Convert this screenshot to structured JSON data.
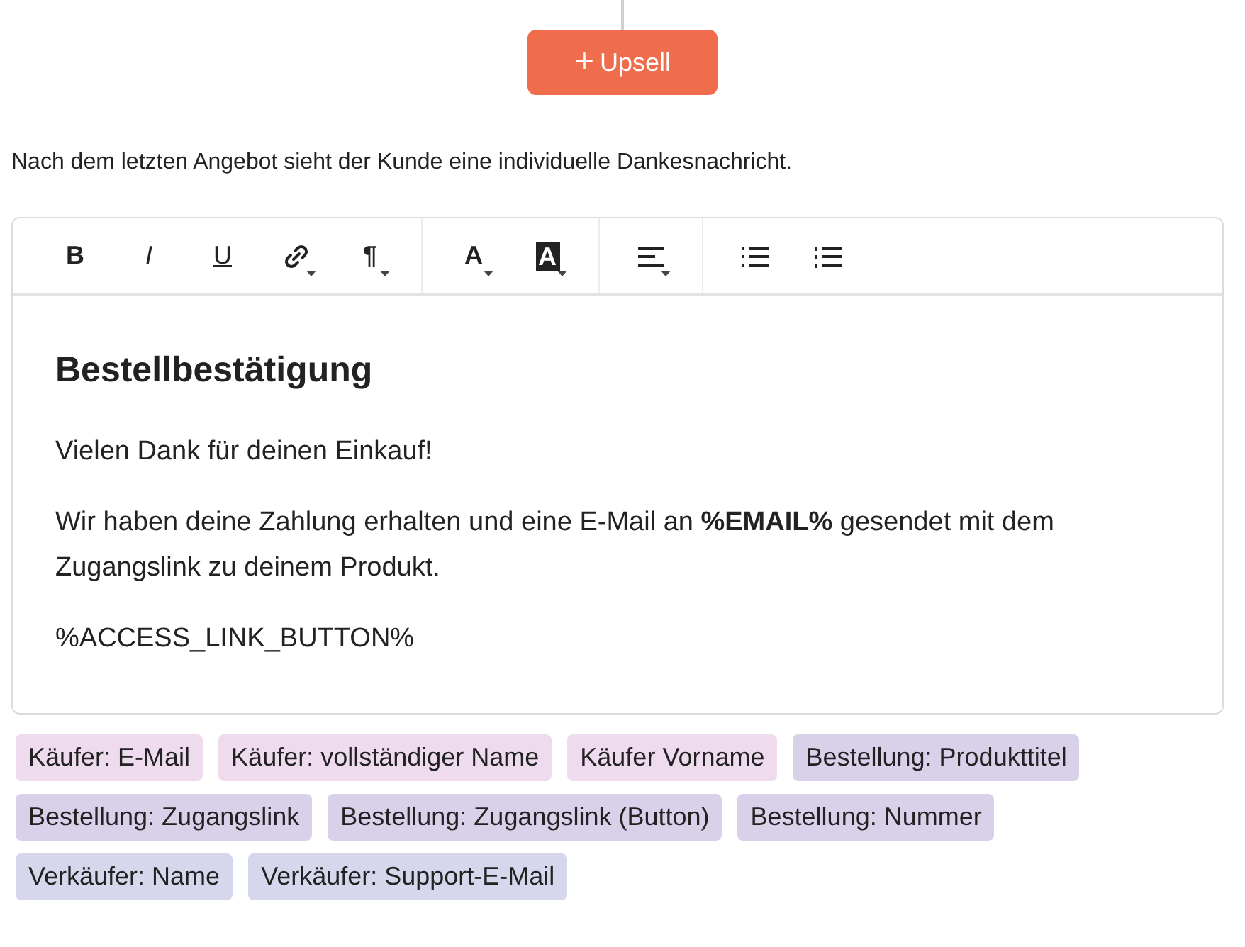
{
  "add_button": {
    "icon": "+",
    "label": "Upsell"
  },
  "description": "Nach dem letzten Angebot sieht der Kunde eine individuelle Dankesnachricht.",
  "toolbar": [
    [
      {
        "kind": "bold",
        "text": "B",
        "has_menu": false
      },
      {
        "kind": "italic",
        "text": "I",
        "has_menu": false
      },
      {
        "kind": "underline",
        "text": "U",
        "has_menu": false
      },
      {
        "kind": "link",
        "has_menu": true
      },
      {
        "kind": "paragraph",
        "text": "¶",
        "has_menu": true
      }
    ],
    [
      {
        "kind": "text_color",
        "text": "A",
        "has_menu": true
      },
      {
        "kind": "highlight",
        "text": "A",
        "has_menu": true
      }
    ],
    [
      {
        "kind": "align",
        "has_menu": true
      }
    ],
    [
      {
        "kind": "bullets",
        "has_menu": false
      },
      {
        "kind": "numbers",
        "has_menu": false
      }
    ]
  ],
  "content": {
    "heading": "Bestellbestätigung",
    "paragraphs": [
      "Vielen Dank für deinen Einkauf!",
      "Wir haben deine Zahlung erhalten und eine E-Mail an **%EMAIL%** gesendet mit dem Zugangslink zu deinem Produkt.",
      "%ACCESS_LINK_BUTTON%"
    ]
  },
  "placeholders": [
    {
      "label": "Käufer: E-Mail",
      "color": "#eedcee"
    },
    {
      "label": "Käufer: vollständiger Name",
      "color": "#eedcee"
    },
    {
      "label": "Käufer Vorname",
      "color": "#eedcee"
    },
    {
      "label": "Bestellung: Produkttitel",
      "color": "#d9d0ea"
    },
    {
      "label": "Bestellung: Zugangslink",
      "color": "#d9d0ea"
    },
    {
      "label": "Bestellung: Zugangslink (Button)",
      "color": "#d9d0ea"
    },
    {
      "label": "Bestellung: Nummer",
      "color": "#d9d0ea"
    },
    {
      "label": "Verkäufer: Name",
      "color": "#d6d6ec"
    },
    {
      "label": "Verkäufer: Support-E-Mail",
      "color": "#d6d6ec"
    }
  ]
}
